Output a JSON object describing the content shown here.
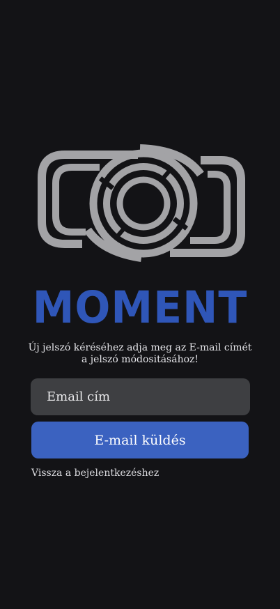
{
  "brand": {
    "name": "MOMENT",
    "color": "#2f56b8",
    "logo_icon": "camera-lens-logo-icon"
  },
  "reset": {
    "subtitle_line1": "Új jelszó kéréséhez adja meg az E-mail címét",
    "subtitle_line2": "a jelszó módositásához!"
  },
  "form": {
    "email_placeholder": "Email cím",
    "email_value": "",
    "send_label": "E-mail küldés",
    "button_color": "#3b62c0"
  },
  "footer": {
    "back_label": "Vissza a bejelentkezéshez"
  }
}
